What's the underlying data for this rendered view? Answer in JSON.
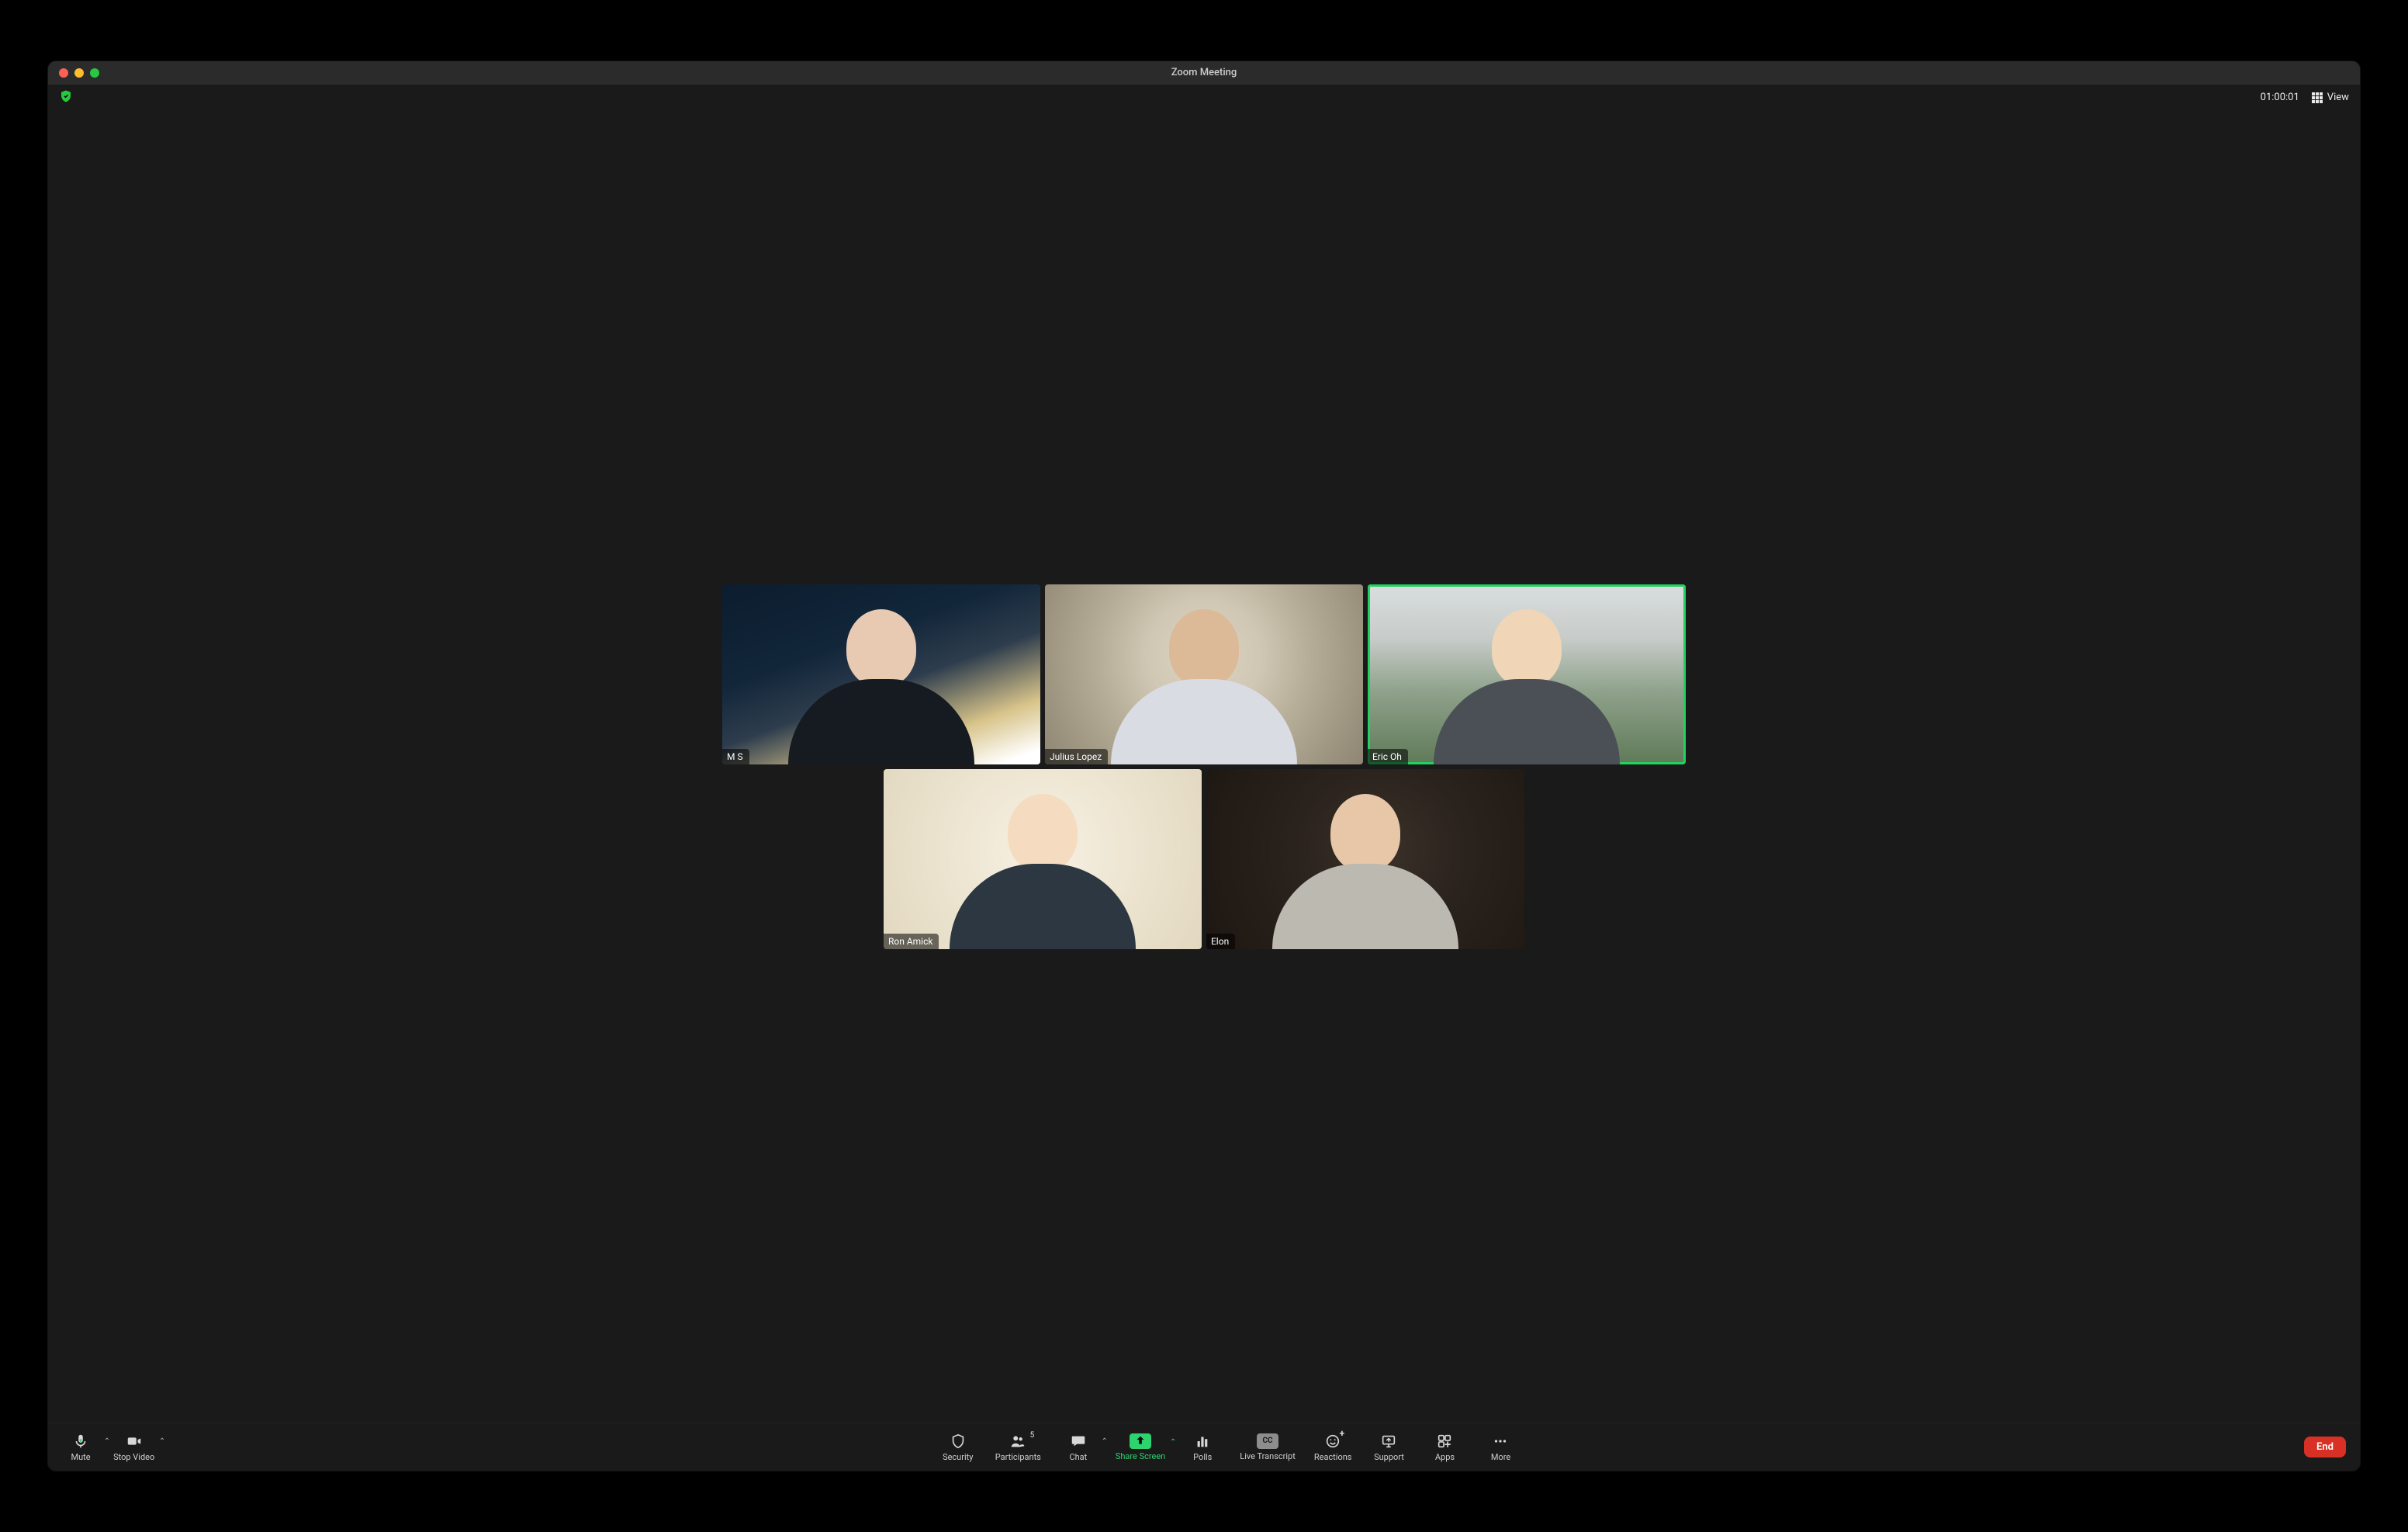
{
  "title": "Zoom Meeting",
  "timer": "01:00:01",
  "view_label": "View",
  "participants": [
    {
      "name": "M S",
      "speaking": false
    },
    {
      "name": "Julius Lopez",
      "speaking": false
    },
    {
      "name": "Eric Oh",
      "speaking": true
    },
    {
      "name": "Ron Amick",
      "speaking": false
    },
    {
      "name": "Elon",
      "speaking": false
    }
  ],
  "controls": {
    "mute": "Mute",
    "stop_video": "Stop Video",
    "security": "Security",
    "participants": "Participants",
    "participants_count": "5",
    "chat": "Chat",
    "share": "Share Screen",
    "polls": "Polls",
    "live_transcript": "Live Transcript",
    "cc_badge": "CC",
    "reactions": "Reactions",
    "support": "Support",
    "apps": "Apps",
    "more": "More",
    "end": "End"
  }
}
